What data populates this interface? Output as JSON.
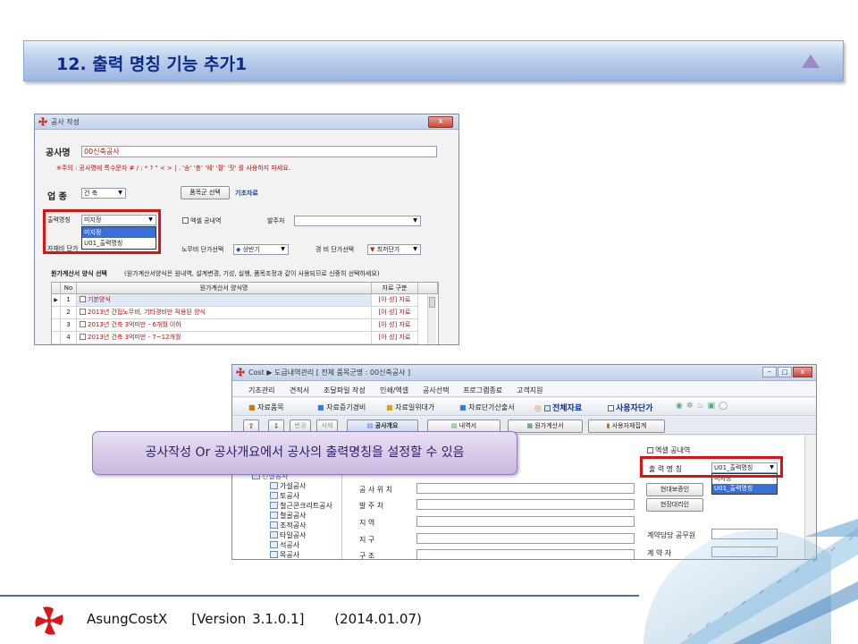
{
  "slide": {
    "title": "12. 출력 명칭 기능 추가1",
    "callout": "공사작성 Or 공사개요에서 공사의 출력명칭을 설정할 수 있음",
    "footer": "AsungCostX    [Version 3.1.0.1]     (2014.01.07)"
  },
  "dialog": {
    "title": "공사 작성",
    "close": "x",
    "project_label": "공사명",
    "project_value": "00신축공사",
    "notice": "※주의 : 공사명에 특수문자 # / : * ? \" < > | . '송' '충' '웨' '팔' '잣' 를 사용하지 마세요.",
    "category_label": "업  종",
    "category_value": "건  축",
    "btn_select": "품목군 선택",
    "basic_data": "기초자료",
    "output_label": "출력명칭",
    "output_value": "미지정",
    "output_options": [
      "미지정",
      "U01_출력명칭"
    ],
    "excel_check": "엑셀 공내역",
    "orderer_label": "발주처",
    "unit_label_left": "자재비 단가",
    "labor_label": "노무비 단가선택",
    "labor_value": "상반기",
    "expense_label": "경  비 단가선택",
    "expense_value": "최저단가",
    "section_title": "원가계산서 양식 선택",
    "section_note": "(원가계산서양식은 원내역, 설계변경, 기성, 실행, 품목조정과 같이 사용되므로 신중히 선택하세요)",
    "grid": {
      "headers": [
        "No",
        "원가계산서 양식명",
        "자료 구분"
      ],
      "rows": [
        {
          "no": "1",
          "name": "기본양식",
          "type": "[아 성] 자료"
        },
        {
          "no": "2",
          "name": "2013년 간접노무비, 기타경비만 적용된 양식",
          "type": "[아 성] 자료"
        },
        {
          "no": "3",
          "name": "2013년 건축 3억미만 - 6개월 이하",
          "type": "[아 성] 자료"
        },
        {
          "no": "4",
          "name": "2013년 건축 3억미만 - 7~12개월",
          "type": "[아 성] 자료"
        }
      ]
    }
  },
  "app": {
    "title_app": "Cost",
    "title_rest": "▶ 도급내역관리 [ 전체 품목군명 : 00신축공사 ]",
    "menu": [
      "기초관리",
      "견적서",
      "조달파일 작성",
      "인쇄/엑셀",
      "공사선택",
      "프로그램종료",
      "고객지원"
    ],
    "toolbar": {
      "item1": "자료품목",
      "item2": "자료증기경비",
      "item3": "자료일위대가",
      "item4": "자료단가산출서",
      "check_all": "전체자료",
      "check_user": "사용자단가"
    },
    "nav": {
      "change": "변경",
      "delete": "삭제"
    },
    "tabs": [
      "공사개요",
      "내역서",
      "원가계산서",
      "사용자재집계"
    ],
    "excel_check": "엑셀 공내역",
    "output_label": "출  력  명  칭",
    "output_value": "U01_출력명칭",
    "output_options": [
      "미지정",
      "U01_출력명칭"
    ],
    "fields": [
      "공 사 위 치",
      "발    주    처",
      "지          역",
      "지          구",
      "구          조"
    ],
    "btn_proxy": "현대보증인",
    "btn_site": "현장대리인",
    "contact_label": "계약담당 공무원",
    "contractor_label": "계    약    자",
    "tree": [
      "건설공사",
      "가설공사",
      "토공사",
      "철근콘크리트공사",
      "철골공사",
      "조적공사",
      "타일공사",
      "석공사",
      "목공사"
    ]
  }
}
